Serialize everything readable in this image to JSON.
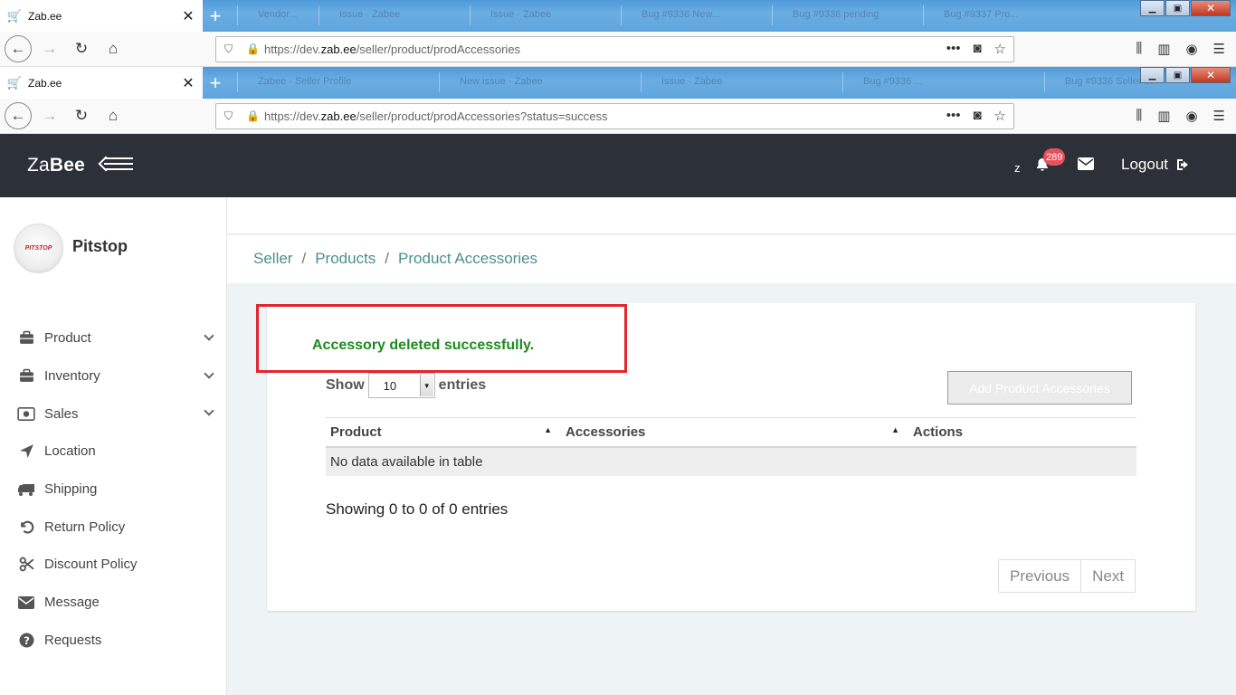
{
  "browser": [
    {
      "tab_title": "Zab.ee",
      "url_prefix": "https://dev.",
      "url_domain": "zab.ee",
      "url_path": "/seller/product/prodAccessories",
      "ghost_tabs": [
        "Vendor...",
        "Issue · Zabee",
        "Issue · Zabee",
        "Bug #9336 New...",
        "Bug #9336 pending",
        "Bug #9337 Pro..."
      ]
    },
    {
      "tab_title": "Zab.ee",
      "url_prefix": "https://dev.",
      "url_domain": "zab.ee",
      "url_path": "/seller/product/prodAccessories?status=success",
      "ghost_tabs": [
        "Zabee - Seller Profile",
        "New issue · Zabee",
        "Issue · Zabee",
        "Bug #9336 ...",
        "Bug #9336 Seller ..."
      ]
    }
  ],
  "header": {
    "brand_light": "Za",
    "brand_bold": "Bee",
    "user_initial": "z",
    "notification_count": "289",
    "logout_label": "Logout"
  },
  "sidebar": {
    "avatar_text": "PITSTOP",
    "shop_name": "Pitstop",
    "items": [
      {
        "label": "Product",
        "icon": "briefcase-icon",
        "expandable": true
      },
      {
        "label": "Inventory",
        "icon": "briefcase-icon",
        "expandable": true
      },
      {
        "label": "Sales",
        "icon": "money-icon",
        "expandable": true
      },
      {
        "label": "Location",
        "icon": "location-arrow-icon",
        "expandable": false
      },
      {
        "label": "Shipping",
        "icon": "truck-icon",
        "expandable": false
      },
      {
        "label": "Return Policy",
        "icon": "undo-icon",
        "expandable": false
      },
      {
        "label": "Discount Policy",
        "icon": "scissors-icon",
        "expandable": false
      },
      {
        "label": "Message",
        "icon": "envelope-icon",
        "expandable": false
      },
      {
        "label": "Requests",
        "icon": "question-circle-icon",
        "expandable": false
      }
    ]
  },
  "breadcrumb": [
    "Seller",
    "Products",
    "Product Accessories"
  ],
  "alert": {
    "message": "Accessory deleted successfully.",
    "color": "#1e8a1e",
    "highlight_color": "#e22530"
  },
  "table_controls": {
    "show_label": "Show",
    "entries_value": "10",
    "entries_label": "entries",
    "add_button_label": "Add Product Accessories"
  },
  "table": {
    "columns": [
      "Product",
      "Accessories",
      "Actions"
    ],
    "empty_message": "No data available in table"
  },
  "footer": {
    "info": "Showing 0 to 0 of 0 entries",
    "prev_label": "Previous",
    "next_label": "Next"
  }
}
